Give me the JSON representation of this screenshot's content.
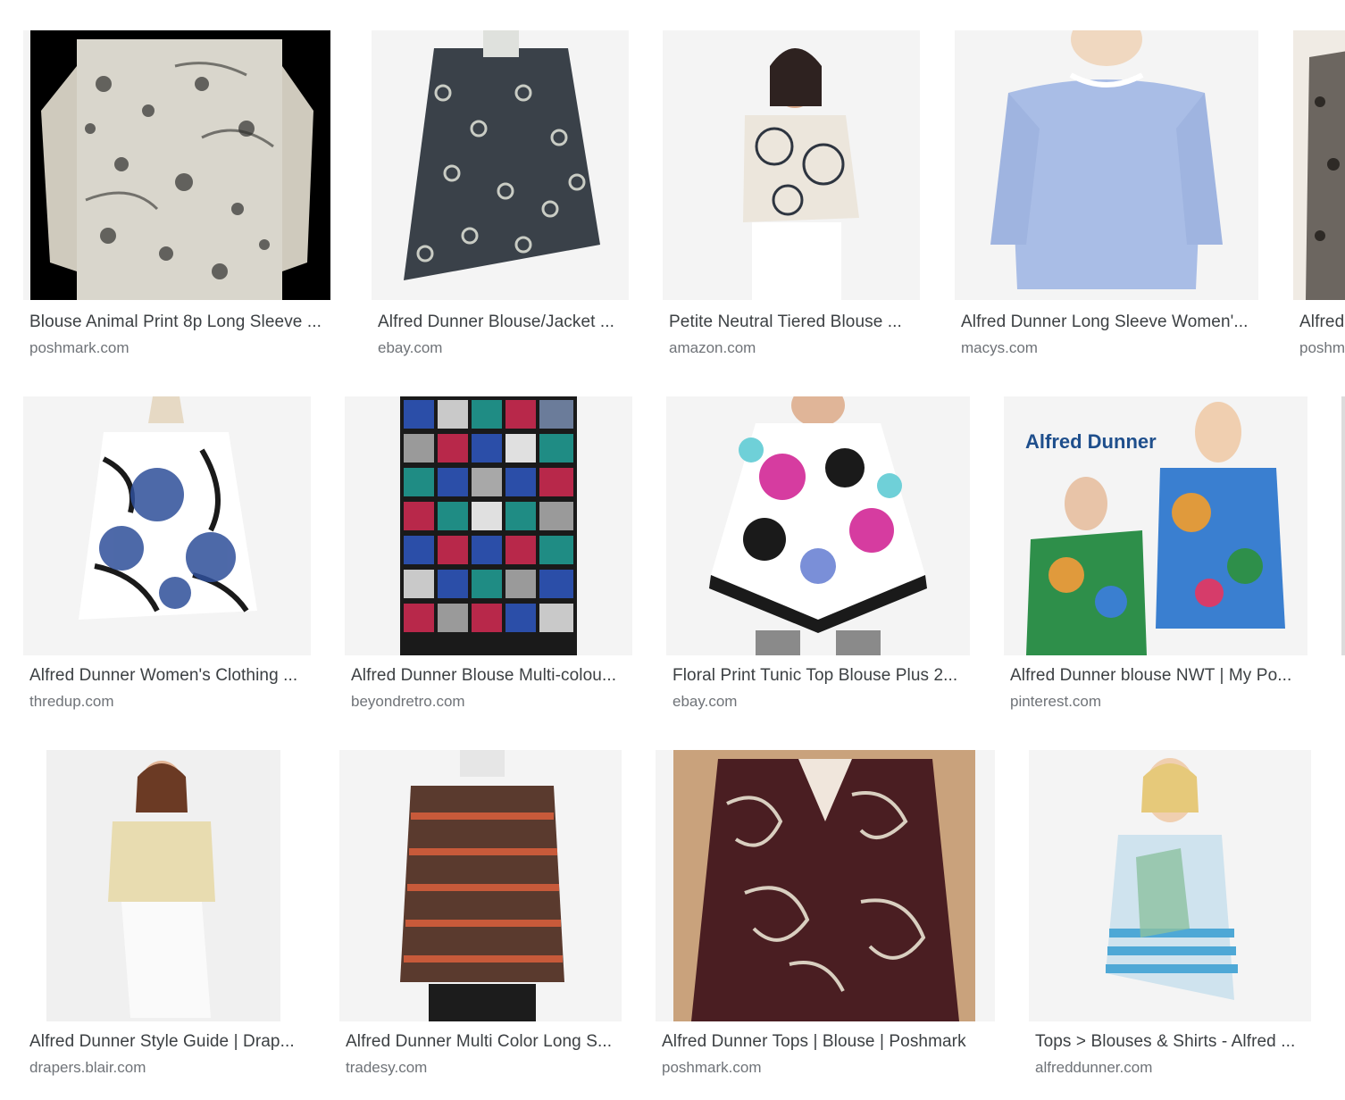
{
  "results": [
    {
      "title": "Blouse Animal Print 8p Long Sleeve ...",
      "domain": "poshmark.com",
      "image": "animal-print-blouse",
      "colors": [
        "#000000",
        "#d9d6cc",
        "#3b3b38"
      ]
    },
    {
      "title": "Alfred Dunner Blouse/Jacket ...",
      "domain": "ebay.com",
      "image": "dark-print-blouse",
      "colors": [
        "#f4f4f4",
        "#3a4149",
        "#c9ccc4"
      ]
    },
    {
      "title": "Petite Neutral Tiered Blouse ...",
      "domain": "amazon.com",
      "image": "floral-short-sleeve-blouse",
      "colors": [
        "#f4f4f4",
        "#ece6dc",
        "#2e3540"
      ]
    },
    {
      "title": "Alfred Dunner Long Sleeve Women'...",
      "domain": "macys.com",
      "image": "blue-sweater",
      "colors": [
        "#f4f4f4",
        "#a9bde6",
        "#f0d8c0"
      ]
    },
    {
      "title": "Alfred",
      "domain": "poshm",
      "image": "partial-animal-print",
      "colors": [
        "#f0ebe4",
        "#6c6660",
        "#2e2a26"
      ]
    },
    {
      "title": "Alfred Dunner Women's Clothing ...",
      "domain": "thredup.com",
      "image": "zebra-blue-jacket",
      "colors": [
        "#f4f4f4",
        "#2f4f9a",
        "#1a1a1a"
      ]
    },
    {
      "title": "Alfred Dunner Blouse Multi-colou...",
      "domain": "beyondretro.com",
      "image": "checkered-blouse",
      "colors": [
        "#f4f4f4",
        "#2b4ea8",
        "#1f8c84"
      ]
    },
    {
      "title": "Floral Print Tunic Top Blouse Plus 2...",
      "domain": "ebay.com",
      "image": "floral-tunic",
      "colors": [
        "#f4f4f4",
        "#d63ca0",
        "#1a1a1a"
      ]
    },
    {
      "title": "Alfred Dunner blouse NWT | My Po...",
      "domain": "pinterest.com",
      "image": "tropical-print-tops",
      "colors": [
        "#f4f4f4",
        "#2e8f4a",
        "#3a7fd0"
      ]
    },
    {
      "title": "Alfred Dunner Style Guide | Drap...",
      "domain": "drapers.blair.com",
      "image": "pastel-top-white-pants",
      "colors": [
        "#f0f0f0",
        "#e8dcb0",
        "#fafafa"
      ]
    },
    {
      "title": "Alfred Dunner Multi Color Long S...",
      "domain": "tradesy.com",
      "image": "paisley-long-sleeve",
      "colors": [
        "#f4f4f4",
        "#5a3a2e",
        "#1c1c1c"
      ]
    },
    {
      "title": "Alfred Dunner Tops | Blouse | Poshmark",
      "domain": "poshmark.com",
      "image": "paisley-button-shirt",
      "colors": [
        "#c9a27c",
        "#4a1e22",
        "#1c2030"
      ]
    },
    {
      "title": "Tops > Blouses & Shirts - Alfred ...",
      "domain": "alfreddunner.com",
      "image": "striped-blue-tunic",
      "colors": [
        "#f4f4f4",
        "#4ea8d6",
        "#cfe3ee"
      ]
    }
  ]
}
